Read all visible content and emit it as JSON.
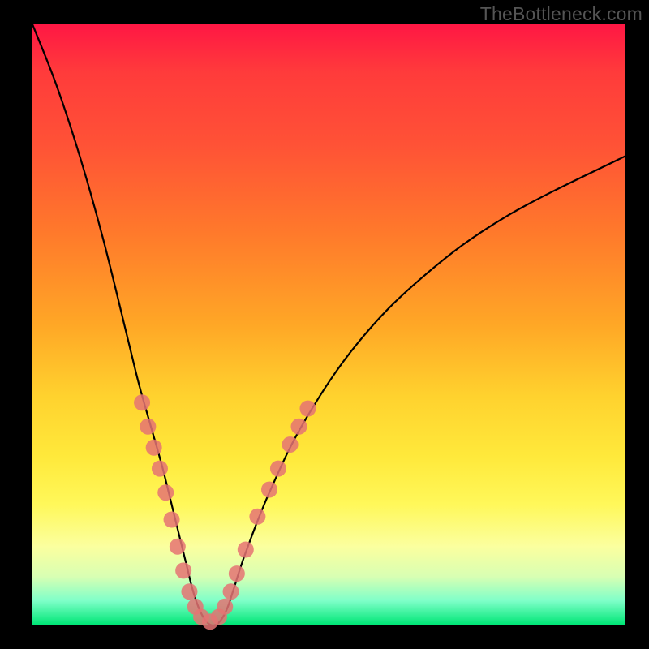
{
  "watermark": "TheBottleneck.com",
  "chart_data": {
    "type": "line",
    "title": "",
    "xlabel": "",
    "ylabel": "",
    "xlim": [
      0,
      100
    ],
    "ylim": [
      0,
      100
    ],
    "series": [
      {
        "name": "bottleneck-curve",
        "x": [
          0,
          4,
          8,
          12,
          16,
          18,
          20,
          22,
          24,
          26,
          27,
          28,
          29,
          30,
          31,
          32,
          33,
          34,
          36,
          40,
          46,
          55,
          66,
          80,
          100
        ],
        "values": [
          100,
          90,
          78,
          64,
          48,
          40,
          33,
          26,
          18,
          10,
          6,
          3,
          1,
          0,
          0,
          1,
          3,
          6,
          12,
          22,
          34,
          47,
          58,
          68,
          78
        ]
      }
    ],
    "dots": {
      "name": "highlighted-points",
      "color": "#e57373",
      "radius": 10,
      "points": [
        {
          "x": 18.5,
          "y": 37
        },
        {
          "x": 19.5,
          "y": 33
        },
        {
          "x": 20.5,
          "y": 29.5
        },
        {
          "x": 21.5,
          "y": 26
        },
        {
          "x": 22.5,
          "y": 22
        },
        {
          "x": 23.5,
          "y": 17.5
        },
        {
          "x": 24.5,
          "y": 13
        },
        {
          "x": 25.5,
          "y": 9
        },
        {
          "x": 26.5,
          "y": 5.5
        },
        {
          "x": 27.5,
          "y": 3
        },
        {
          "x": 28.5,
          "y": 1.3
        },
        {
          "x": 30.0,
          "y": 0.5
        },
        {
          "x": 31.5,
          "y": 1.3
        },
        {
          "x": 32.5,
          "y": 3
        },
        {
          "x": 33.5,
          "y": 5.5
        },
        {
          "x": 34.5,
          "y": 8.5
        },
        {
          "x": 36.0,
          "y": 12.5
        },
        {
          "x": 38.0,
          "y": 18
        },
        {
          "x": 40.0,
          "y": 22.5
        },
        {
          "x": 41.5,
          "y": 26
        },
        {
          "x": 43.5,
          "y": 30
        },
        {
          "x": 45.0,
          "y": 33
        },
        {
          "x": 46.5,
          "y": 36
        }
      ]
    }
  }
}
